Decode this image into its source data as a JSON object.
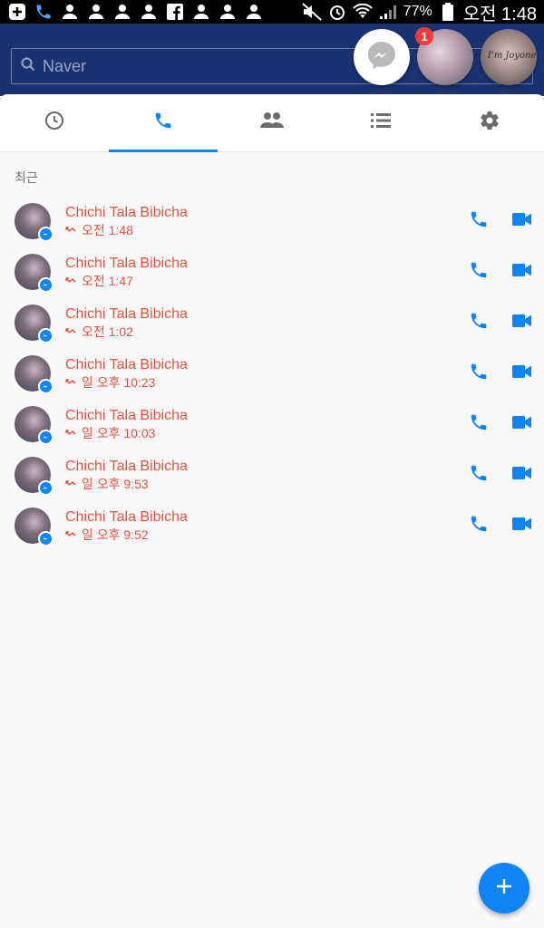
{
  "status_bar": {
    "battery_percent": "77%",
    "time": "오전 1:48"
  },
  "search": {
    "placeholder": "Naver"
  },
  "chat_heads": {
    "badge_count": "1",
    "avatar_text": "I'm Joyone"
  },
  "tabs": [
    {
      "icon": "clock-icon",
      "active": false
    },
    {
      "icon": "phone-icon",
      "active": true
    },
    {
      "icon": "people-icon",
      "active": false
    },
    {
      "icon": "list-icon",
      "active": false
    },
    {
      "icon": "gear-icon",
      "active": false
    }
  ],
  "section": {
    "label": "최근"
  },
  "calls": [
    {
      "name": "Chichi Tala Bibicha",
      "time": "오전 1:48"
    },
    {
      "name": "Chichi Tala Bibicha",
      "time": "오전 1:47"
    },
    {
      "name": "Chichi Tala Bibicha",
      "time": "오전 1:02"
    },
    {
      "name": "Chichi Tala Bibicha",
      "time": "일 오후 10:23"
    },
    {
      "name": "Chichi Tala Bibicha",
      "time": "일 오후 10:03"
    },
    {
      "name": "Chichi Tala Bibicha",
      "time": "일 오후 9:53"
    },
    {
      "name": "Chichi Tala Bibicha",
      "time": "일 오후 9:52"
    }
  ],
  "fab": {
    "icon": "plus-icon"
  },
  "colors": {
    "accent": "#0f84f6",
    "missed": "#e9503d",
    "header": "#1a3270"
  }
}
